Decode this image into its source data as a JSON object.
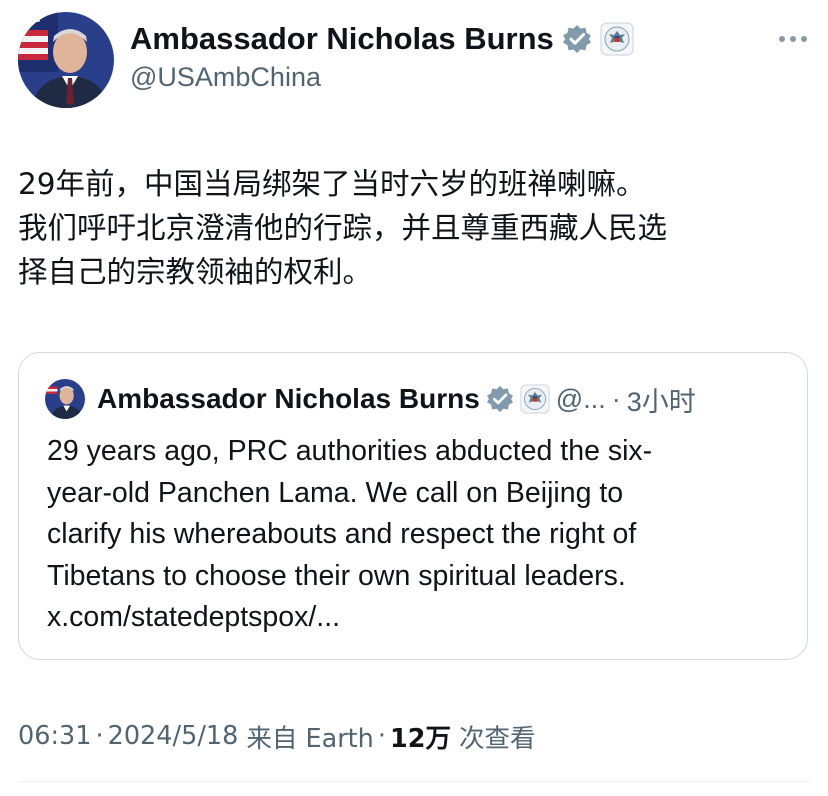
{
  "author": {
    "display_name": "Ambassador Nicholas Burns",
    "handle": "@USAmbChina",
    "avatar_icon": "ambassador-portrait-avatar",
    "verified_icon": "gray-verified-badge-icon",
    "affiliation_icon": "us-state-department-seal-icon"
  },
  "more_icon": "more-options-icon",
  "tweet": {
    "lines": [
      "29年前，中国当局绑架了当时六岁的班禅喇嘛。",
      "我们呼吁北京澄清他的行踪，并且尊重西藏人民选",
      "择自己的宗教领袖的权利。"
    ]
  },
  "quoted_tweet": {
    "display_name": "Ambassador Nicholas Burns",
    "handle": "@...",
    "separator": "·",
    "time": "3小时",
    "lines": [
      "29 years ago, PRC authorities abducted the six-",
      "year-old Panchen Lama.  We call on Beijing to",
      "clarify his whereabouts and respect the right of",
      "Tibetans to choose their own spiritual leaders.",
      "x.com/statedeptspox/..."
    ]
  },
  "meta": {
    "time": "06:31",
    "sep1": "·",
    "date": "2024/5/18",
    "source": "来自 Earth",
    "sep2": "·",
    "views_count": "12万",
    "views_label": "次查看"
  },
  "colors": {
    "text_primary": "#0f1419",
    "text_secondary": "#536471",
    "border": "#cfd9de",
    "verified_gray": "#829aab"
  }
}
